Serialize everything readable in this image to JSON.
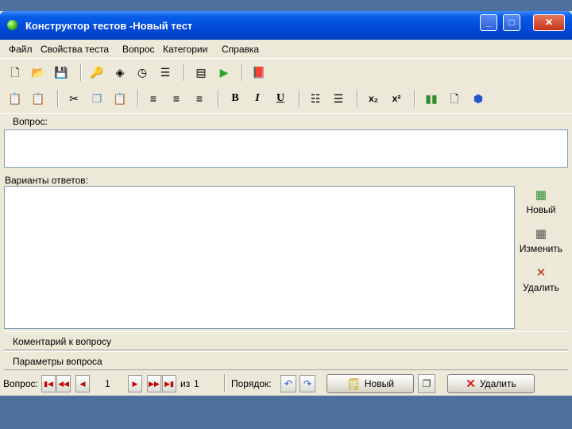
{
  "window": {
    "title": "Конструктор тестов -Новый тест"
  },
  "menu": [
    "Файл",
    "Свойства теста",
    "Вопрос",
    "Категории",
    "Справка"
  ],
  "fields": {
    "question_label": "Вопрос:",
    "answers_label": "Варианты ответов:"
  },
  "side_buttons": {
    "new": "Новый",
    "edit": "Изменить",
    "delete": "Удалить"
  },
  "sections": {
    "comment": "Коментарий к вопросу",
    "params": "Параметры вопроса"
  },
  "navigation": {
    "question_label": "Вопрос:",
    "current": "1",
    "of_label": "из",
    "total": "1",
    "order_label": "Порядок:",
    "new_button": "Новый",
    "delete_button": "Удалить"
  },
  "toolbar1_icons": [
    "new-file-icon",
    "open-folder-icon",
    "save-icon",
    "key-icon",
    "diamond-icon",
    "clock-icon",
    "numbered-list-icon",
    "notepad-icon",
    "play-icon",
    "book-icon"
  ],
  "toolbar2_icons": [
    "paste-doc-icon",
    "paste-icon",
    "cut-icon",
    "copy-icon",
    "paste-clip-icon",
    "align-left-icon",
    "align-center-icon",
    "align-right-icon",
    "bold-icon",
    "italic-icon",
    "underline-icon",
    "bullet-list-icon",
    "ordered-list-icon",
    "subscript-icon",
    "superscript-icon",
    "chart-icon",
    "page-icon",
    "cube-icon"
  ],
  "toolbar_text": {
    "bold": "B",
    "italic": "I",
    "underline": "U",
    "subscript": "x₂",
    "superscript": "x²"
  },
  "colors": {
    "titlebar": "#0049d8",
    "desktop": "#4f6f9c",
    "window_bg": "#ece9d8"
  }
}
